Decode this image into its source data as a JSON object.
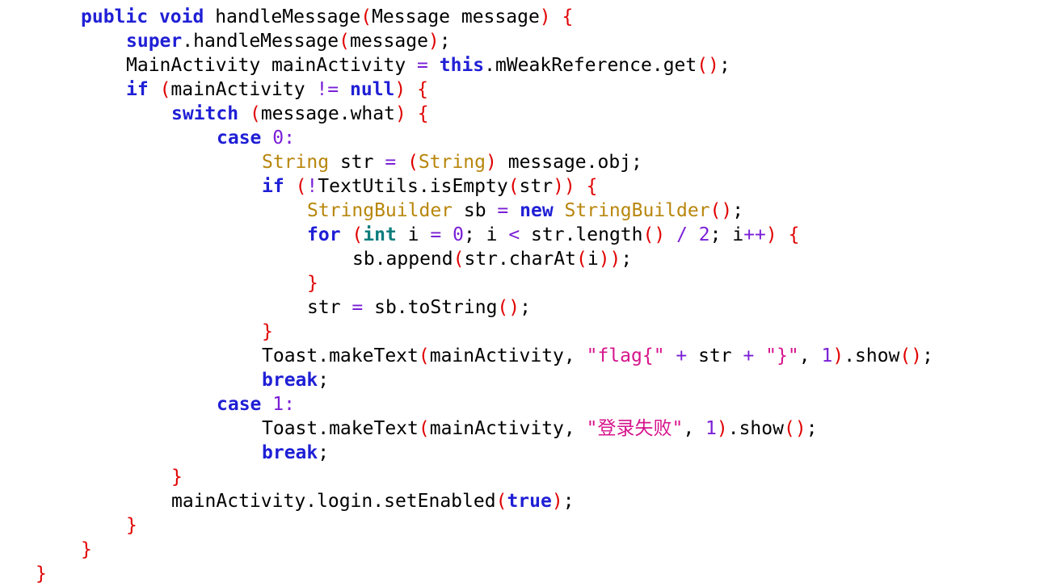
{
  "colors": {
    "keyword": "#1f1fd6",
    "keyword_alt": "#0b7d7d",
    "type": "#b8860b",
    "number": "#7a1fd6",
    "string": "#d6148c",
    "bracket": "#e00000",
    "text": "#000000",
    "background": "#ffffff"
  },
  "code": {
    "lines": [
      {
        "indent": 2,
        "tokens": [
          {
            "t": "kw",
            "v": "public"
          },
          {
            "t": "plain",
            "v": " "
          },
          {
            "t": "kw",
            "v": "void"
          },
          {
            "t": "plain",
            "v": " handleMessage"
          },
          {
            "t": "punc",
            "v": "("
          },
          {
            "t": "plain",
            "v": "Message message"
          },
          {
            "t": "punc",
            "v": ")"
          },
          {
            "t": "plain",
            "v": " "
          },
          {
            "t": "punc",
            "v": "{"
          }
        ]
      },
      {
        "indent": 3,
        "tokens": [
          {
            "t": "kw",
            "v": "super"
          },
          {
            "t": "plain",
            "v": ".handleMessage"
          },
          {
            "t": "punc",
            "v": "("
          },
          {
            "t": "plain",
            "v": "message"
          },
          {
            "t": "punc",
            "v": ")"
          },
          {
            "t": "plain",
            "v": ";"
          }
        ]
      },
      {
        "indent": 3,
        "tokens": [
          {
            "t": "plain",
            "v": "MainActivity mainActivity "
          },
          {
            "t": "op",
            "v": "="
          },
          {
            "t": "plain",
            "v": " "
          },
          {
            "t": "kw",
            "v": "this"
          },
          {
            "t": "plain",
            "v": ".mWeakReference.get"
          },
          {
            "t": "punc",
            "v": "()"
          },
          {
            "t": "plain",
            "v": ";"
          }
        ]
      },
      {
        "indent": 3,
        "tokens": [
          {
            "t": "kw",
            "v": "if"
          },
          {
            "t": "plain",
            "v": " "
          },
          {
            "t": "punc",
            "v": "("
          },
          {
            "t": "plain",
            "v": "mainActivity "
          },
          {
            "t": "op",
            "v": "!="
          },
          {
            "t": "plain",
            "v": " "
          },
          {
            "t": "kw",
            "v": "null"
          },
          {
            "t": "punc",
            "v": ")"
          },
          {
            "t": "plain",
            "v": " "
          },
          {
            "t": "punc",
            "v": "{"
          }
        ]
      },
      {
        "indent": 4,
        "tokens": [
          {
            "t": "kw",
            "v": "switch"
          },
          {
            "t": "plain",
            "v": " "
          },
          {
            "t": "punc",
            "v": "("
          },
          {
            "t": "plain",
            "v": "message.what"
          },
          {
            "t": "punc",
            "v": ")"
          },
          {
            "t": "plain",
            "v": " "
          },
          {
            "t": "punc",
            "v": "{"
          }
        ]
      },
      {
        "indent": 5,
        "tokens": [
          {
            "t": "kw",
            "v": "case"
          },
          {
            "t": "plain",
            "v": " "
          },
          {
            "t": "num",
            "v": "0"
          },
          {
            "t": "op",
            "v": ":"
          }
        ]
      },
      {
        "indent": 6,
        "tokens": [
          {
            "t": "type",
            "v": "String"
          },
          {
            "t": "plain",
            "v": " str "
          },
          {
            "t": "op",
            "v": "="
          },
          {
            "t": "plain",
            "v": " "
          },
          {
            "t": "punc",
            "v": "("
          },
          {
            "t": "type",
            "v": "String"
          },
          {
            "t": "punc",
            "v": ")"
          },
          {
            "t": "plain",
            "v": " message.obj;"
          }
        ]
      },
      {
        "indent": 6,
        "tokens": [
          {
            "t": "kw",
            "v": "if"
          },
          {
            "t": "plain",
            "v": " "
          },
          {
            "t": "punc",
            "v": "("
          },
          {
            "t": "op",
            "v": "!"
          },
          {
            "t": "plain",
            "v": "TextUtils.isEmpty"
          },
          {
            "t": "punc",
            "v": "("
          },
          {
            "t": "plain",
            "v": "str"
          },
          {
            "t": "punc",
            "v": "))"
          },
          {
            "t": "plain",
            "v": " "
          },
          {
            "t": "punc",
            "v": "{"
          }
        ]
      },
      {
        "indent": 7,
        "tokens": [
          {
            "t": "type",
            "v": "StringBuilder"
          },
          {
            "t": "plain",
            "v": " sb "
          },
          {
            "t": "op",
            "v": "="
          },
          {
            "t": "plain",
            "v": " "
          },
          {
            "t": "kw",
            "v": "new"
          },
          {
            "t": "plain",
            "v": " "
          },
          {
            "t": "type",
            "v": "StringBuilder"
          },
          {
            "t": "punc",
            "v": "()"
          },
          {
            "t": "plain",
            "v": ";"
          }
        ]
      },
      {
        "indent": 7,
        "tokens": [
          {
            "t": "kw",
            "v": "for"
          },
          {
            "t": "plain",
            "v": " "
          },
          {
            "t": "punc",
            "v": "("
          },
          {
            "t": "kw2",
            "v": "int"
          },
          {
            "t": "plain",
            "v": " i "
          },
          {
            "t": "op",
            "v": "="
          },
          {
            "t": "plain",
            "v": " "
          },
          {
            "t": "num",
            "v": "0"
          },
          {
            "t": "plain",
            "v": "; i "
          },
          {
            "t": "op",
            "v": "<"
          },
          {
            "t": "plain",
            "v": " str.length"
          },
          {
            "t": "punc",
            "v": "()"
          },
          {
            "t": "plain",
            "v": " "
          },
          {
            "t": "op",
            "v": "/"
          },
          {
            "t": "plain",
            "v": " "
          },
          {
            "t": "num",
            "v": "2"
          },
          {
            "t": "plain",
            "v": "; i"
          },
          {
            "t": "op",
            "v": "++"
          },
          {
            "t": "punc",
            "v": ")"
          },
          {
            "t": "plain",
            "v": " "
          },
          {
            "t": "punc",
            "v": "{"
          }
        ]
      },
      {
        "indent": 8,
        "tokens": [
          {
            "t": "plain",
            "v": "sb.append"
          },
          {
            "t": "punc",
            "v": "("
          },
          {
            "t": "plain",
            "v": "str.charAt"
          },
          {
            "t": "punc",
            "v": "("
          },
          {
            "t": "plain",
            "v": "i"
          },
          {
            "t": "punc",
            "v": "))"
          },
          {
            "t": "plain",
            "v": ";"
          }
        ]
      },
      {
        "indent": 7,
        "tokens": [
          {
            "t": "punc",
            "v": "}"
          }
        ]
      },
      {
        "indent": 7,
        "tokens": [
          {
            "t": "plain",
            "v": "str "
          },
          {
            "t": "op",
            "v": "="
          },
          {
            "t": "plain",
            "v": " sb.toString"
          },
          {
            "t": "punc",
            "v": "()"
          },
          {
            "t": "plain",
            "v": ";"
          }
        ]
      },
      {
        "indent": 6,
        "tokens": [
          {
            "t": "punc",
            "v": "}"
          }
        ]
      },
      {
        "indent": 6,
        "tokens": [
          {
            "t": "plain",
            "v": "Toast.makeText"
          },
          {
            "t": "punc",
            "v": "("
          },
          {
            "t": "plain",
            "v": "mainActivity, "
          },
          {
            "t": "str",
            "v": "\"flag{\""
          },
          {
            "t": "plain",
            "v": " "
          },
          {
            "t": "op",
            "v": "+"
          },
          {
            "t": "plain",
            "v": " str "
          },
          {
            "t": "op",
            "v": "+"
          },
          {
            "t": "plain",
            "v": " "
          },
          {
            "t": "str",
            "v": "\"}\""
          },
          {
            "t": "plain",
            "v": ", "
          },
          {
            "t": "num",
            "v": "1"
          },
          {
            "t": "punc",
            "v": ")"
          },
          {
            "t": "plain",
            "v": ".show"
          },
          {
            "t": "punc",
            "v": "()"
          },
          {
            "t": "plain",
            "v": ";"
          }
        ]
      },
      {
        "indent": 6,
        "tokens": [
          {
            "t": "kw",
            "v": "break"
          },
          {
            "t": "plain",
            "v": ";"
          }
        ]
      },
      {
        "indent": 5,
        "tokens": [
          {
            "t": "kw",
            "v": "case"
          },
          {
            "t": "plain",
            "v": " "
          },
          {
            "t": "num",
            "v": "1"
          },
          {
            "t": "op",
            "v": ":"
          }
        ]
      },
      {
        "indent": 6,
        "tokens": [
          {
            "t": "plain",
            "v": "Toast.makeText"
          },
          {
            "t": "punc",
            "v": "("
          },
          {
            "t": "plain",
            "v": "mainActivity, "
          },
          {
            "t": "str",
            "v": "\"登录失败\""
          },
          {
            "t": "plain",
            "v": ", "
          },
          {
            "t": "num",
            "v": "1"
          },
          {
            "t": "punc",
            "v": ")"
          },
          {
            "t": "plain",
            "v": ".show"
          },
          {
            "t": "punc",
            "v": "()"
          },
          {
            "t": "plain",
            "v": ";"
          }
        ]
      },
      {
        "indent": 6,
        "tokens": [
          {
            "t": "kw",
            "v": "break"
          },
          {
            "t": "plain",
            "v": ";"
          }
        ]
      },
      {
        "indent": 4,
        "tokens": [
          {
            "t": "punc",
            "v": "}"
          }
        ]
      },
      {
        "indent": 4,
        "tokens": [
          {
            "t": "plain",
            "v": "mainActivity.login.setEnabled"
          },
          {
            "t": "punc",
            "v": "("
          },
          {
            "t": "kw",
            "v": "true"
          },
          {
            "t": "punc",
            "v": ")"
          },
          {
            "t": "plain",
            "v": ";"
          }
        ]
      },
      {
        "indent": 3,
        "tokens": [
          {
            "t": "punc",
            "v": "}"
          }
        ]
      },
      {
        "indent": 2,
        "tokens": [
          {
            "t": "punc",
            "v": "}"
          }
        ]
      },
      {
        "indent": 1,
        "tokens": [
          {
            "t": "punc",
            "v": "}"
          }
        ]
      }
    ]
  }
}
